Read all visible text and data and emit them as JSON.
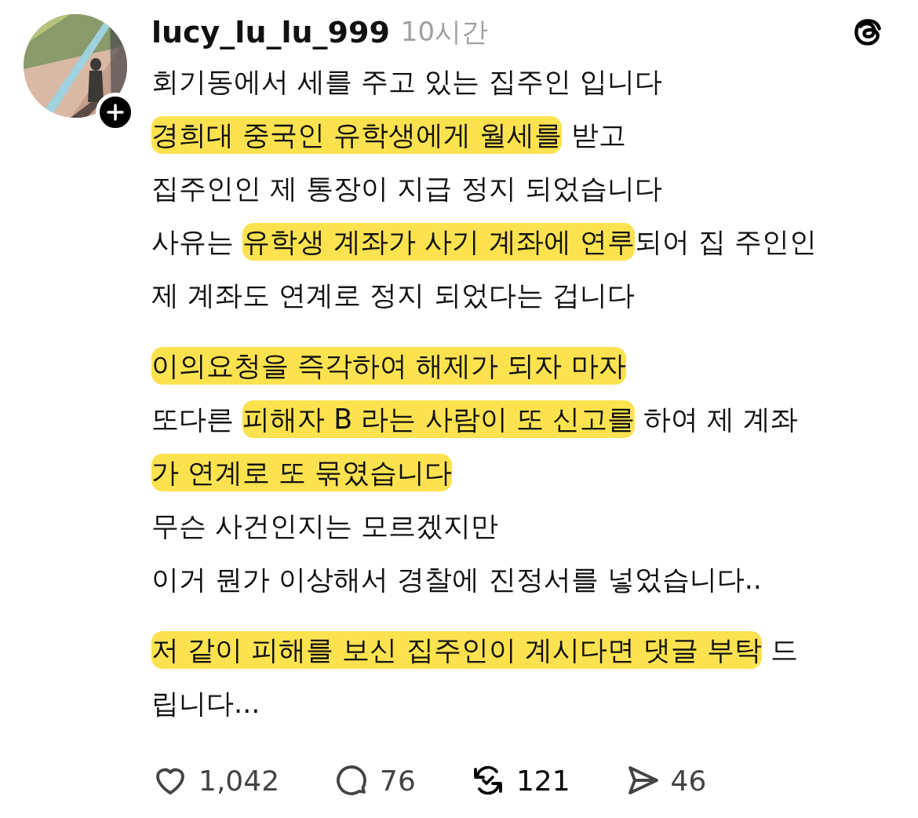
{
  "post": {
    "author": "lucy_lu_lu_999",
    "time": "10시간",
    "paragraphs": [
      {
        "lines": [
          [
            {
              "text": "회기동에서 세를 주고 있는 집주인 입니다",
              "highlighted": false
            }
          ],
          [
            {
              "text": "경희대 중국인 유학생에게 월세를",
              "highlighted": true
            },
            {
              "text": " 받고",
              "highlighted": false
            }
          ],
          [
            {
              "text": "집주인인 제 통장이 지급 정지 되었습니다",
              "highlighted": false
            }
          ],
          [
            {
              "text": "사유는 ",
              "highlighted": false
            },
            {
              "text": "유학생 계좌가 사기 계좌에 연루",
              "highlighted": true
            },
            {
              "text": "되어 집 주인인",
              "highlighted": false
            }
          ],
          [
            {
              "text": "제 계좌도 연계로 정지 되었다는 겁니다",
              "highlighted": false
            }
          ]
        ]
      },
      {
        "lines": [
          [
            {
              "text": "이의요청을 즉각하여 해제가 되자 마자",
              "highlighted": true
            }
          ],
          [
            {
              "text": "또다른 ",
              "highlighted": false
            },
            {
              "text": "피해자 B 라는 사람이 또 신고를",
              "highlighted": true
            },
            {
              "text": " 하여 제 계좌",
              "highlighted": false
            }
          ],
          [
            {
              "text": "가 연계로 또 묶였습니다",
              "highlighted": true
            }
          ],
          [
            {
              "text": "무슨 사건인지는 모르겠지만",
              "highlighted": false
            }
          ],
          [
            {
              "text": "이거 뭔가 이상해서 경찰에 진정서를 넣었습니다..",
              "highlighted": false
            }
          ]
        ]
      },
      {
        "lines": [
          [
            {
              "text": "저 같이 피해를 보신 집주인이 계시다면 댓글 부탁",
              "highlighted": true
            },
            {
              "text": " 드",
              "highlighted": false
            }
          ],
          [
            {
              "text": "립니다...",
              "highlighted": false
            }
          ]
        ]
      }
    ],
    "actions": [
      {
        "kind": "like",
        "count": "1,042",
        "selected": false
      },
      {
        "kind": "reply",
        "count": "76",
        "selected": false
      },
      {
        "kind": "repost",
        "count": "121",
        "selected": true
      },
      {
        "kind": "share",
        "count": "46",
        "selected": false
      }
    ]
  }
}
